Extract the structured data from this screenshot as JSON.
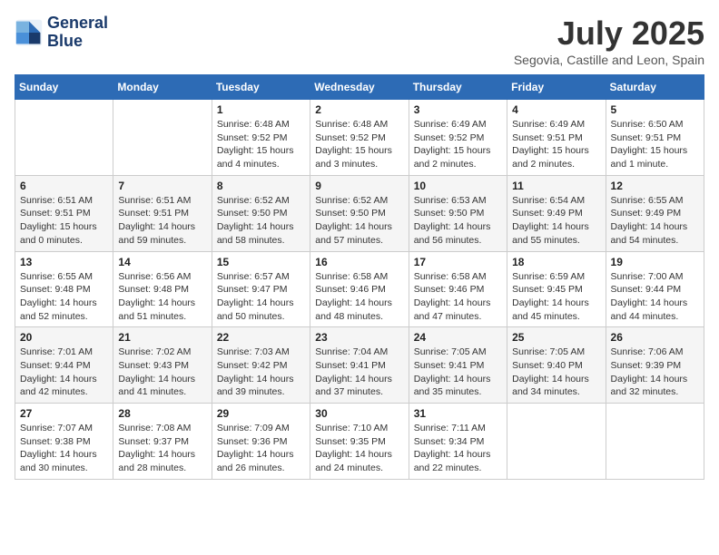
{
  "logo": {
    "line1": "General",
    "line2": "Blue"
  },
  "title": "July 2025",
  "location": "Segovia, Castille and Leon, Spain",
  "days_header": [
    "Sunday",
    "Monday",
    "Tuesday",
    "Wednesday",
    "Thursday",
    "Friday",
    "Saturday"
  ],
  "weeks": [
    [
      {
        "day": "",
        "info": ""
      },
      {
        "day": "",
        "info": ""
      },
      {
        "day": "1",
        "sunrise": "6:48 AM",
        "sunset": "9:52 PM",
        "daylight": "15 hours and 4 minutes."
      },
      {
        "day": "2",
        "sunrise": "6:48 AM",
        "sunset": "9:52 PM",
        "daylight": "15 hours and 3 minutes."
      },
      {
        "day": "3",
        "sunrise": "6:49 AM",
        "sunset": "9:52 PM",
        "daylight": "15 hours and 2 minutes."
      },
      {
        "day": "4",
        "sunrise": "6:49 AM",
        "sunset": "9:51 PM",
        "daylight": "15 hours and 2 minutes."
      },
      {
        "day": "5",
        "sunrise": "6:50 AM",
        "sunset": "9:51 PM",
        "daylight": "15 hours and 1 minute."
      }
    ],
    [
      {
        "day": "6",
        "sunrise": "6:51 AM",
        "sunset": "9:51 PM",
        "daylight": "15 hours and 0 minutes."
      },
      {
        "day": "7",
        "sunrise": "6:51 AM",
        "sunset": "9:51 PM",
        "daylight": "14 hours and 59 minutes."
      },
      {
        "day": "8",
        "sunrise": "6:52 AM",
        "sunset": "9:50 PM",
        "daylight": "14 hours and 58 minutes."
      },
      {
        "day": "9",
        "sunrise": "6:52 AM",
        "sunset": "9:50 PM",
        "daylight": "14 hours and 57 minutes."
      },
      {
        "day": "10",
        "sunrise": "6:53 AM",
        "sunset": "9:50 PM",
        "daylight": "14 hours and 56 minutes."
      },
      {
        "day": "11",
        "sunrise": "6:54 AM",
        "sunset": "9:49 PM",
        "daylight": "14 hours and 55 minutes."
      },
      {
        "day": "12",
        "sunrise": "6:55 AM",
        "sunset": "9:49 PM",
        "daylight": "14 hours and 54 minutes."
      }
    ],
    [
      {
        "day": "13",
        "sunrise": "6:55 AM",
        "sunset": "9:48 PM",
        "daylight": "14 hours and 52 minutes."
      },
      {
        "day": "14",
        "sunrise": "6:56 AM",
        "sunset": "9:48 PM",
        "daylight": "14 hours and 51 minutes."
      },
      {
        "day": "15",
        "sunrise": "6:57 AM",
        "sunset": "9:47 PM",
        "daylight": "14 hours and 50 minutes."
      },
      {
        "day": "16",
        "sunrise": "6:58 AM",
        "sunset": "9:46 PM",
        "daylight": "14 hours and 48 minutes."
      },
      {
        "day": "17",
        "sunrise": "6:58 AM",
        "sunset": "9:46 PM",
        "daylight": "14 hours and 47 minutes."
      },
      {
        "day": "18",
        "sunrise": "6:59 AM",
        "sunset": "9:45 PM",
        "daylight": "14 hours and 45 minutes."
      },
      {
        "day": "19",
        "sunrise": "7:00 AM",
        "sunset": "9:44 PM",
        "daylight": "14 hours and 44 minutes."
      }
    ],
    [
      {
        "day": "20",
        "sunrise": "7:01 AM",
        "sunset": "9:44 PM",
        "daylight": "14 hours and 42 minutes."
      },
      {
        "day": "21",
        "sunrise": "7:02 AM",
        "sunset": "9:43 PM",
        "daylight": "14 hours and 41 minutes."
      },
      {
        "day": "22",
        "sunrise": "7:03 AM",
        "sunset": "9:42 PM",
        "daylight": "14 hours and 39 minutes."
      },
      {
        "day": "23",
        "sunrise": "7:04 AM",
        "sunset": "9:41 PM",
        "daylight": "14 hours and 37 minutes."
      },
      {
        "day": "24",
        "sunrise": "7:05 AM",
        "sunset": "9:41 PM",
        "daylight": "14 hours and 35 minutes."
      },
      {
        "day": "25",
        "sunrise": "7:05 AM",
        "sunset": "9:40 PM",
        "daylight": "14 hours and 34 minutes."
      },
      {
        "day": "26",
        "sunrise": "7:06 AM",
        "sunset": "9:39 PM",
        "daylight": "14 hours and 32 minutes."
      }
    ],
    [
      {
        "day": "27",
        "sunrise": "7:07 AM",
        "sunset": "9:38 PM",
        "daylight": "14 hours and 30 minutes."
      },
      {
        "day": "28",
        "sunrise": "7:08 AM",
        "sunset": "9:37 PM",
        "daylight": "14 hours and 28 minutes."
      },
      {
        "day": "29",
        "sunrise": "7:09 AM",
        "sunset": "9:36 PM",
        "daylight": "14 hours and 26 minutes."
      },
      {
        "day": "30",
        "sunrise": "7:10 AM",
        "sunset": "9:35 PM",
        "daylight": "14 hours and 24 minutes."
      },
      {
        "day": "31",
        "sunrise": "7:11 AM",
        "sunset": "9:34 PM",
        "daylight": "14 hours and 22 minutes."
      },
      {
        "day": "",
        "info": ""
      },
      {
        "day": "",
        "info": ""
      }
    ]
  ]
}
